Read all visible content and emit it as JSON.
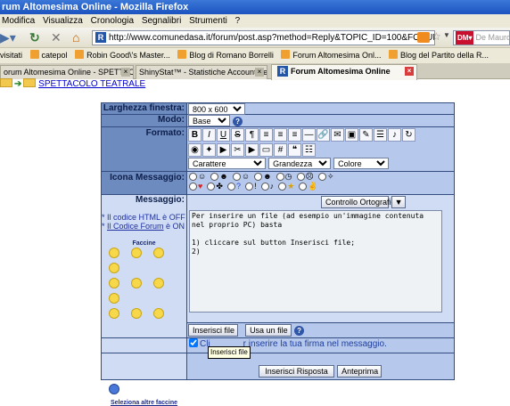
{
  "window": {
    "title": "rum Altomesima Online - Mozilla Firefox"
  },
  "menu": [
    "Modifica",
    "Visualizza",
    "Cronologia",
    "Segnalibri",
    "Strumenti",
    "?"
  ],
  "urlbar": {
    "value": "http://www.comunedasa.it/forum/post.asp?method=Reply&TOPIC_ID=100&FORUM_ID=6"
  },
  "search": {
    "placeholder": "De Mauro"
  },
  "bookmarks": [
    "visitati",
    "catepol",
    "Robin Good\\'s Master...",
    "Blog di Romano Borrelli",
    "Forum Altomesima Onl...",
    "Blog del Partito della R..."
  ],
  "tabs": [
    {
      "label": "orum Altomesima Online - SPETTACOL..."
    },
    {
      "label": "ShinyStat™ - Statistiche Account peppi..."
    },
    {
      "label": "Forum Altomesima Online"
    }
  ],
  "breadcrumb": {
    "link": "SPETTACOLO TEATRALE"
  },
  "form": {
    "width_label": "Larghezza finestra:",
    "width_value": "800 x 600",
    "mode_label": "Modo:",
    "mode_value": "Base",
    "format_label": "Formato:",
    "fonts_value": "Carattere",
    "size_value": "Grandezza",
    "color_value": "Colore",
    "icon_label": "Icona Messaggio:",
    "message_label": "Messaggio:",
    "html_note": "* Il codice HTML è OFF",
    "forum_code_prefix": "* ",
    "forum_code_link": "Il Codice Forum",
    "forum_code_suffix": " è ON",
    "smilies_title": "Faccine",
    "more_smilies": "Seleziona altre faccine",
    "spellcheck": "Controllo Ortografico",
    "textarea": "Per inserire un file (ad esempio un'immagine contenuta nel proprio PC) basta\n\n1) cliccare sul button Inserisci file;\n2)",
    "insert_file": "Inserisci file",
    "use_file": "Usa un file",
    "signature_prefix": "Cli",
    "signature_text": "r inserire la tua firma nel messaggio.",
    "submit": "Inserisci Risposta",
    "preview": "Anteprima",
    "tooltip": "Inserisci file"
  }
}
